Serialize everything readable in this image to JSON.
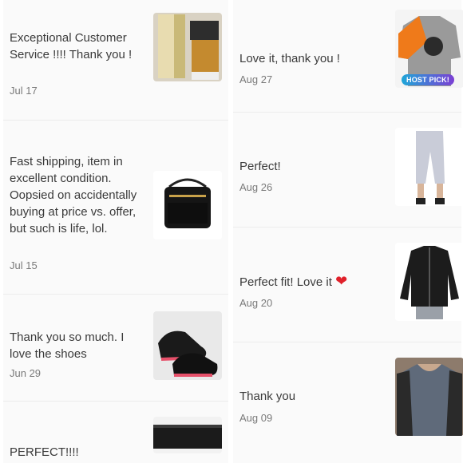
{
  "left_reviews": [
    {
      "text": "Exceptional Customer Service !!!! Thank you !",
      "date": "Jul 17",
      "item_image": "bathroom-accessories-photo"
    },
    {
      "text": "Fast shipping, item in excellent condition. Oopsied on accidentally buying at price vs. offer, but such is life, lol.",
      "date": "Jul 15",
      "item_image": "black-crossbody-bag-photo"
    },
    {
      "text": "Thank you so much. I love the shoes",
      "date": "Jun 29",
      "item_image": "black-sneakers-photo"
    },
    {
      "text": "PERFECT!!!!",
      "date": "",
      "item_image": "black-leather-item-photo"
    }
  ],
  "right_reviews": [
    {
      "text": "Love it, thank you !",
      "date": "Aug 27",
      "item_image": "orange-gray-hoodie-photo",
      "badge": "HOST PICK!"
    },
    {
      "text": "Perfect!",
      "date": "Aug 26",
      "item_image": "gray-capri-leggings-photo"
    },
    {
      "text": "Perfect fit! Love it",
      "date": "Aug 20",
      "item_image": "black-zip-jacket-photo",
      "emoji": "❤"
    },
    {
      "text": "Thank you",
      "date": "Aug 09",
      "item_image": "gray-graphic-top-photo"
    }
  ],
  "colors": {
    "background": "#fafafa",
    "text": "#3a3a3a",
    "date": "#7a7a7a",
    "badge_start": "#1fa6d8",
    "badge_end": "#7b3fd4",
    "heart": "#e0202a"
  }
}
